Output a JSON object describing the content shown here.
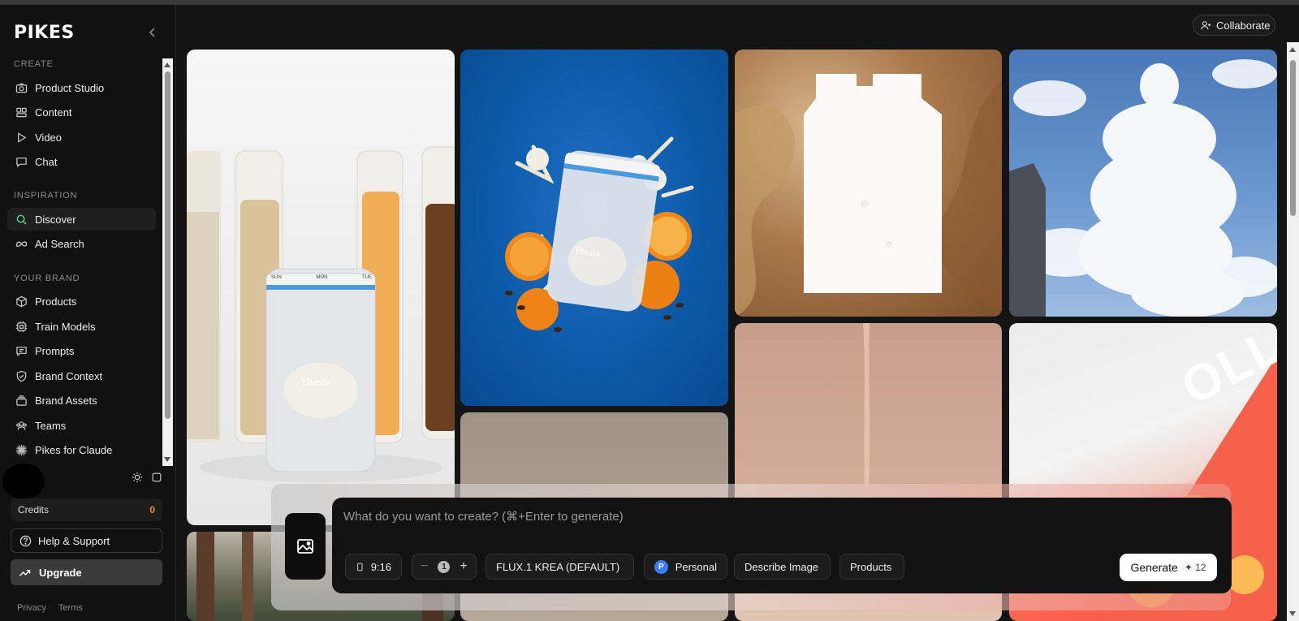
{
  "app": {
    "logo": "PIKES"
  },
  "sidebar": {
    "sections": {
      "create": "CREATE",
      "inspiration": "INSPIRATION",
      "brand": "YOUR BRAND"
    },
    "items": [
      {
        "label": "Product Studio",
        "icon": "camera-icon"
      },
      {
        "label": "Content",
        "icon": "grid-icon"
      },
      {
        "label": "Video",
        "icon": "play-icon"
      },
      {
        "label": "Chat",
        "icon": "chat-icon"
      },
      {
        "label": "Discover",
        "icon": "search-icon",
        "active": true
      },
      {
        "label": "Ad Search",
        "icon": "meta-icon"
      },
      {
        "label": "Products",
        "icon": "box-icon"
      },
      {
        "label": "Train Models",
        "icon": "chip-icon"
      },
      {
        "label": "Prompts",
        "icon": "message-icon"
      },
      {
        "label": "Brand Context",
        "icon": "shield-icon"
      },
      {
        "label": "Brand Assets",
        "icon": "layers-icon"
      },
      {
        "label": "Teams",
        "icon": "users-icon"
      },
      {
        "label": "Pikes for Claude",
        "icon": "sparkle-icon"
      }
    ],
    "credits": {
      "label": "Credits",
      "value": "0"
    },
    "help": "Help & Support",
    "upgrade": "Upgrade",
    "footer": {
      "privacy": "Privacy",
      "terms": "Terms"
    }
  },
  "header": {
    "collaborate": "Collaborate"
  },
  "prompt": {
    "placeholder": "What do you want to create? (⌘+Enter to generate)",
    "aspect": "9:16",
    "quantity": "1",
    "model": "FLUX.1 KREA (DEFAULT)",
    "workspace_badge": "P",
    "workspace": "Personal",
    "describe": "Describe Image",
    "products": "Products",
    "generate": "Generate",
    "generate_cost": "✦ 12"
  },
  "gallery": {
    "thesis_brand": "Thesis",
    "days": [
      "SUN",
      "MON",
      "TUE"
    ],
    "oll_text": "OLL"
  },
  "colors": {
    "accent_green": "#5ad48a",
    "credits_orange": "#f08a2e",
    "blue_badge": "#3b7bf5"
  }
}
